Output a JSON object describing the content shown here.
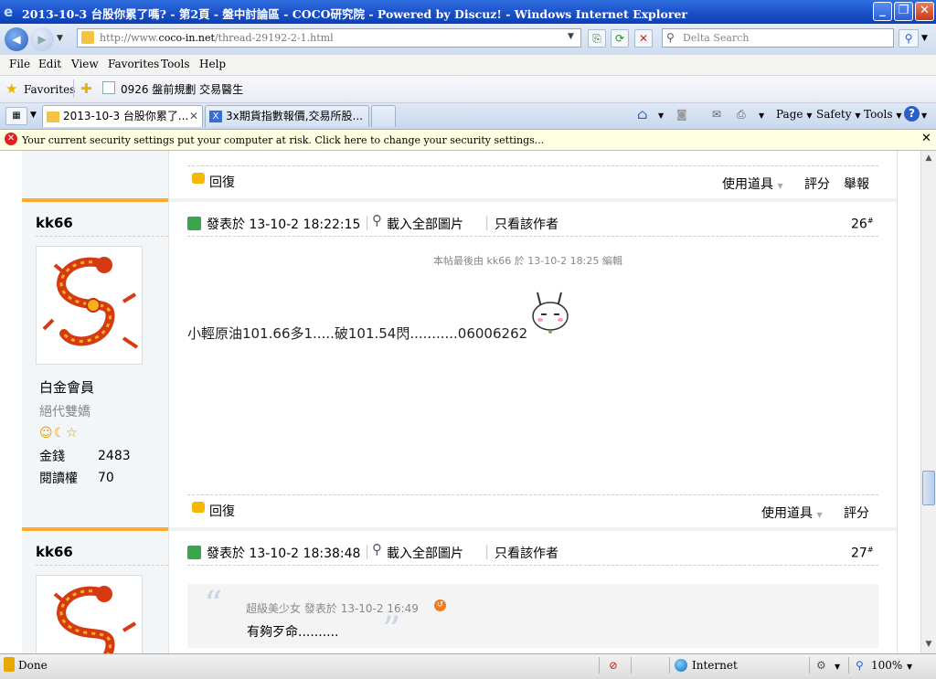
{
  "window": {
    "title": "2013-10-3 台股你累了嗎? - 第2頁 - 盤中討論區 - COCO研究院 - Powered by Discuz! - Windows Internet Explorer",
    "min": "_",
    "max": "❐",
    "close": "✕"
  },
  "address": {
    "url_prefix": "http://www.",
    "url_host": "coco-in.net",
    "url_path": "/thread-29192-2-1.html",
    "search_placeholder": "Delta Search"
  },
  "menu": [
    "File",
    "Edit",
    "View",
    "Favorites",
    "Tools",
    "Help"
  ],
  "favorites": {
    "label": "Favorites",
    "link": "0926 盤前規劃 交易醫生"
  },
  "tabs": [
    {
      "label": "2013-10-3 台股你累了...",
      "active": true
    },
    {
      "label": "3x期貨指數報價,交易所股...",
      "active": false
    }
  ],
  "commandbar": {
    "page": "Page",
    "safety": "Safety",
    "tools": "Tools"
  },
  "infobar": {
    "text": "Your current security settings put your computer at risk. Click here to change your security settings..."
  },
  "content": {
    "top_actions": {
      "reply": "回復",
      "tools": "使用道具",
      "rate": "評分",
      "report": "舉報"
    },
    "posts": [
      {
        "author": "kk66",
        "rank": "白金會員",
        "title": "絕代雙嬌",
        "stats": [
          {
            "label": "金錢",
            "value": "2483"
          },
          {
            "label": "閱讀權",
            "value": "70"
          }
        ],
        "posted_label": "發表於",
        "posted": "13-10-2 18:22:15",
        "load_images": "載入全部圖片",
        "only_author": "只看該作者",
        "floor": "26",
        "floor_sup": "#",
        "edit_note": "本帖最後由 kk66 於 13-10-2 18:25 編輯",
        "body": "小輕原油101.66多1.....破101.54閃...........06006262",
        "actions": {
          "reply": "回復",
          "tools": "使用道具",
          "rate": "評分"
        }
      },
      {
        "author": "kk66",
        "posted_label": "發表於",
        "posted": "13-10-2 18:38:48",
        "load_images": "載入全部圖片",
        "only_author": "只看該作者",
        "floor": "27",
        "floor_sup": "#",
        "quote": {
          "author": "超級美少女",
          "posted_label": "發表於",
          "time": "13-10-2 16:49",
          "text": "有夠歹命.........."
        }
      }
    ]
  },
  "status": {
    "left": "Done",
    "zone": "Internet",
    "zoom": "100%"
  },
  "colors": {
    "accent_orange": "#ffaa33",
    "title_blue": "#1c50c8",
    "infobar": "#ffffe1"
  }
}
